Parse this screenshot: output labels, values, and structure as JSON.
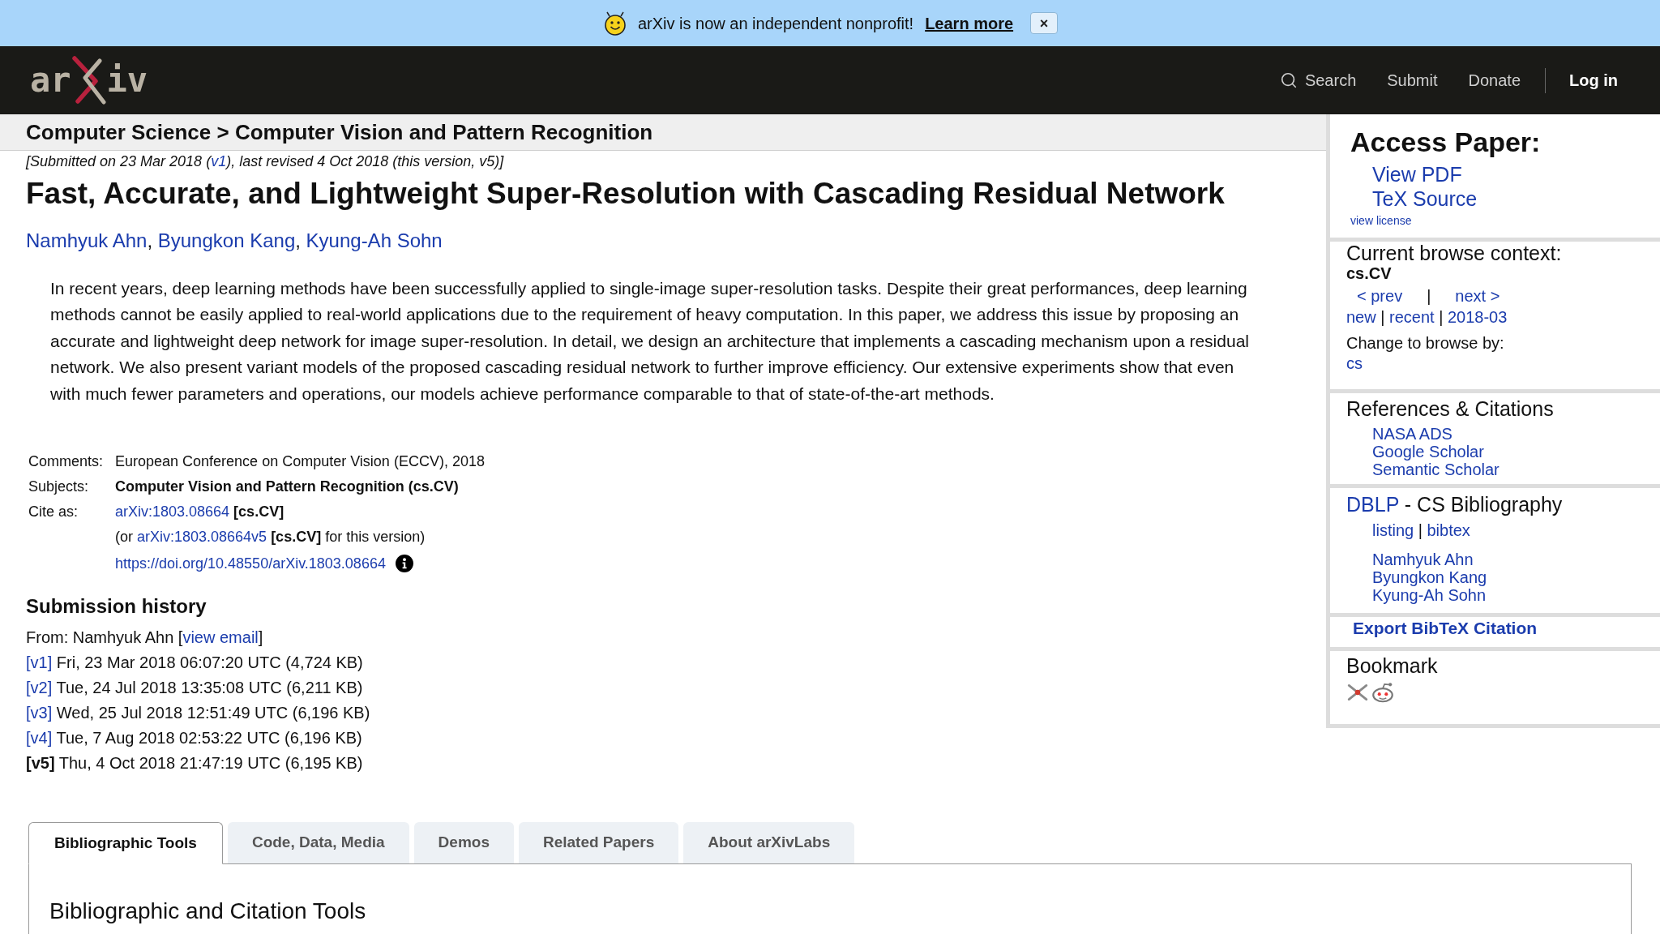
{
  "banner": {
    "message": "arXiv is now an independent nonprofit!",
    "link": "Learn more",
    "close": "×"
  },
  "header": {
    "logo": {
      "left": "ar",
      "right": "iv"
    },
    "nav": [
      {
        "kind": "search",
        "label": "Search"
      },
      {
        "kind": "link",
        "label": "Submit"
      },
      {
        "kind": "link",
        "label": "Donate"
      },
      {
        "kind": "login",
        "label": "Log in"
      }
    ]
  },
  "breadcrumb": "Computer Science > Computer Vision and Pattern Recognition",
  "paper": {
    "dateline": [
      {
        "kind": "text",
        "text": "[Submitted on 23 Mar 2018 ("
      },
      {
        "kind": "link",
        "text": "v1"
      },
      {
        "kind": "text",
        "text": "), last revised 4 Oct 2018 (this version, v5)]"
      }
    ],
    "title": "Fast, Accurate, and Lightweight Super-Resolution with Cascading Residual Network",
    "authors": [
      {
        "kind": "link",
        "text": "Namhyuk Ahn"
      },
      {
        "kind": "text",
        "text": ", "
      },
      {
        "kind": "link",
        "text": "Byungkon Kang"
      },
      {
        "kind": "text",
        "text": ", "
      },
      {
        "kind": "link",
        "text": "Kyung-Ah Sohn"
      }
    ],
    "abstract": "In recent years, deep learning methods have been successfully applied to single-image super-resolution tasks. Despite their great performances, deep learning methods cannot be easily applied to real-world applications due to the requirement of heavy computation. In this paper, we address this issue by proposing an accurate and lightweight deep network for image super-resolution. In detail, we design an architecture that implements a cascading mechanism upon a residual network. We also present variant models of the proposed cascading residual network to further improve efficiency. Our extensive experiments show that even with much fewer parameters and operations, our models achieve performance comparable to that of state-of-the-art methods.",
    "metadata": [
      {
        "label": "Comments:",
        "lines": [
          {
            "kind": "text",
            "segments": [
              {
                "kind": "text",
                "text": "European Conference on Computer Vision (ECCV), 2018"
              }
            ]
          }
        ]
      },
      {
        "label": "Subjects:",
        "lines": [
          {
            "kind": "text",
            "segments": [
              {
                "kind": "bold",
                "text": "Computer Vision and Pattern Recognition (cs.CV)"
              }
            ]
          }
        ]
      },
      {
        "label": "Cite as:",
        "lines": [
          {
            "kind": "text",
            "segments": [
              {
                "kind": "link",
                "text": "arXiv:1803.08664"
              },
              {
                "kind": "bold",
                "text": " [cs.CV]"
              }
            ]
          },
          {
            "kind": "text",
            "segments": [
              {
                "kind": "text",
                "text": "(or "
              },
              {
                "kind": "link",
                "text": "arXiv:1803.08664v5"
              },
              {
                "kind": "bold",
                "text": " [cs.CV]"
              },
              {
                "kind": "text",
                "text": " for this version)"
              }
            ]
          },
          {
            "kind": "doi",
            "segments": [
              {
                "kind": "link",
                "text": "https://doi.org/10.48550/arXiv.1803.08664"
              }
            ]
          }
        ]
      }
    ],
    "submission_history": {
      "heading": "Submission history",
      "from": [
        {
          "kind": "text",
          "text": "From: Namhyuk Ahn ["
        },
        {
          "kind": "link",
          "text": "view email"
        },
        {
          "kind": "text",
          "text": "]"
        }
      ],
      "versions": [
        {
          "label": "[v1]",
          "details": "Fri, 23 Mar 2018 06:07:20 UTC (4,724 KB)",
          "selected": false
        },
        {
          "label": "[v2]",
          "details": "Tue, 24 Jul 2018 13:35:08 UTC (6,211 KB)",
          "selected": false
        },
        {
          "label": "[v3]",
          "details": "Wed, 25 Jul 2018 12:51:49 UTC (6,196 KB)",
          "selected": false
        },
        {
          "label": "[v4]",
          "details": "Tue, 7 Aug 2018 02:53:22 UTC (6,196 KB)",
          "selected": false
        },
        {
          "label": "[v5]",
          "details": "Thu, 4 Oct 2018 21:47:19 UTC (6,195 KB)",
          "selected": true
        }
      ]
    }
  },
  "sidebar": {
    "access_paper": {
      "heading": "Access Paper:",
      "links": [
        "View PDF",
        "TeX Source"
      ],
      "license": "view license"
    },
    "browse_context": {
      "heading": "Current browse context:",
      "category": "cs.CV",
      "nav": [
        {
          "kind": "link",
          "text": "< prev"
        },
        {
          "kind": "text",
          "text": "|"
        },
        {
          "kind": "link",
          "text": "next >"
        }
      ],
      "lists": [
        {
          "kind": "link",
          "text": "new"
        },
        {
          "kind": "text",
          "text": " | "
        },
        {
          "kind": "link",
          "text": "recent"
        },
        {
          "kind": "text",
          "text": " | "
        },
        {
          "kind": "link",
          "text": "2018-03"
        }
      ],
      "change_label": "Change to browse by:",
      "change_links": [
        "cs"
      ]
    },
    "references": {
      "heading": "References & Citations",
      "links": [
        "NASA ADS",
        "Google Scholar",
        "Semantic Scholar"
      ]
    },
    "dblp": {
      "heading": [
        {
          "kind": "link",
          "text": "DBLP"
        },
        {
          "kind": "text",
          "text": " - CS Bibliography"
        }
      ],
      "links": [
        {
          "kind": "link",
          "text": "listing"
        },
        {
          "kind": "text",
          "text": " | "
        },
        {
          "kind": "link",
          "text": "bibtex"
        }
      ],
      "authors": [
        "Namhyuk Ahn",
        "Byungkon Kang",
        "Kyung-Ah Sohn"
      ]
    },
    "export": "Export BibTeX Citation",
    "bookmark": {
      "heading": "Bookmark"
    }
  },
  "tabs": [
    {
      "label": "Bibliographic Tools",
      "selected": true
    },
    {
      "label": "Code, Data, Media",
      "selected": false
    },
    {
      "label": "Demos",
      "selected": false
    },
    {
      "label": "Related Papers",
      "selected": false
    },
    {
      "label": "About arXivLabs",
      "selected": false
    }
  ],
  "tab_panel": {
    "heading": "Bibliographic and Citation Tools"
  }
}
